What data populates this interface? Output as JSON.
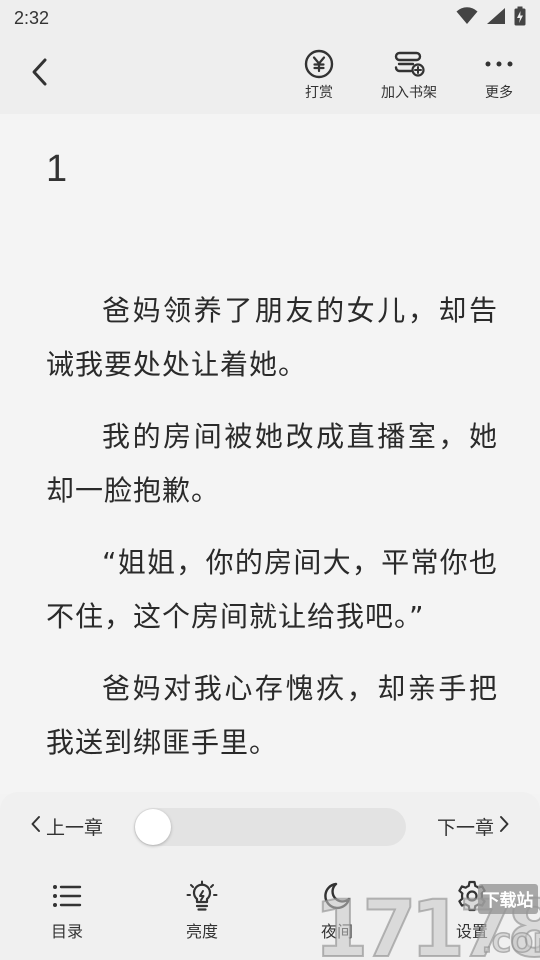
{
  "status_bar": {
    "time": "2:32",
    "icons": [
      "wifi-icon",
      "signal-icon",
      "battery-charging-icon"
    ]
  },
  "top_nav": {
    "back_icon": "chevron-left-icon",
    "actions": [
      {
        "label": "打赏",
        "icon": "yen-coin-icon"
      },
      {
        "label": "加入书架",
        "icon": "add-to-shelf-icon"
      },
      {
        "label": "更多",
        "icon": "more-dots-icon"
      }
    ]
  },
  "reader": {
    "chapter_title": "1",
    "paragraphs": [
      "爸妈领养了朋友的女儿，却告诫我要处处让着她。",
      "我的房间被她改成直播室，她却一脸抱歉。",
      "“姐姐，你的房间大，平常你也不住，这个房间就让给我吧。”",
      "爸妈对我心存愧疚，却亲手把我送到绑匪手里。"
    ]
  },
  "bottom_panel": {
    "prev_chapter": "上一章",
    "next_chapter": "下一章",
    "progress": 0.0,
    "tools": [
      {
        "label": "目录",
        "icon": "list-icon"
      },
      {
        "label": "亮度",
        "icon": "brightness-bulb-icon"
      },
      {
        "label": "夜间",
        "icon": "moon-icon"
      },
      {
        "label": "设置",
        "icon": "gear-icon"
      }
    ]
  },
  "watermark": {
    "text": "17178",
    "suffix": ".COM",
    "badge": "下载站"
  },
  "colors": {
    "background": "#f4f4f4",
    "nav_background": "#eeeeee",
    "text": "#2a2a2a",
    "progress_track": "#e3e3e3"
  }
}
